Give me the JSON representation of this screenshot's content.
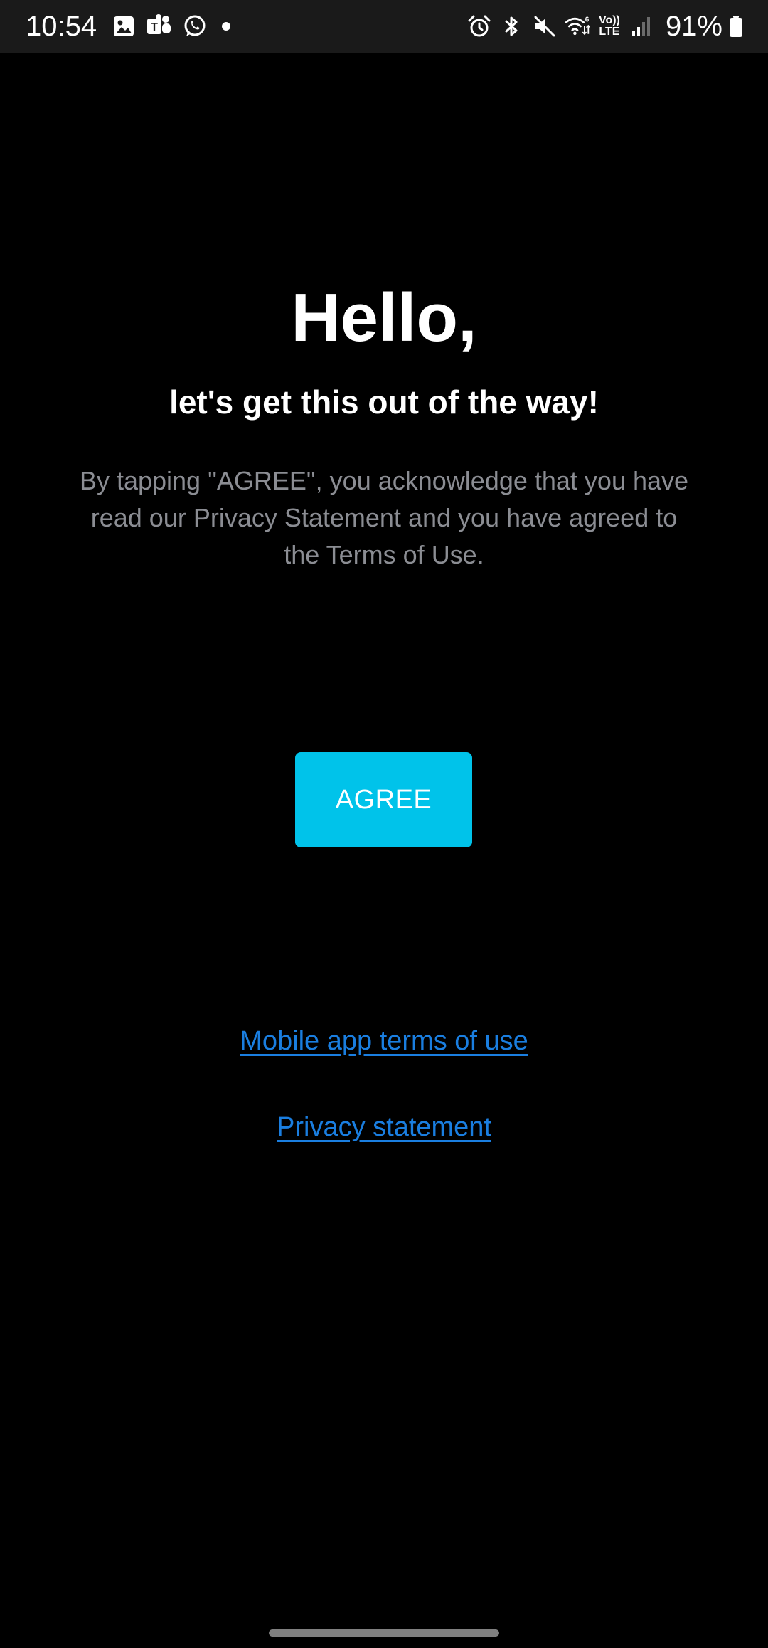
{
  "status_bar": {
    "time": "10:54",
    "left_icons": [
      "gallery-icon",
      "teams-icon",
      "whatsapp-icon",
      "notification-dot-icon"
    ],
    "right_icons": [
      "alarm-icon",
      "bluetooth-icon",
      "mute-icon",
      "wifi-icon",
      "volte-icon",
      "signal-icon",
      "battery-icon"
    ],
    "volte_top": "Vo))",
    "volte_bottom": "LTE",
    "wifi_badge": "6",
    "battery_percent": "91%"
  },
  "main": {
    "title": "Hello,",
    "subtitle": "let's get this out of the way!",
    "description": "By tapping \"AGREE\", you acknowledge that you have read our Privacy Statement and you have agreed to the Terms of Use.",
    "agree_label": "AGREE"
  },
  "links": {
    "terms": "Mobile app terms of use",
    "privacy": "Privacy statement"
  },
  "colors": {
    "background": "#000000",
    "accent_button": "#00c3ea",
    "link": "#1a7ee0",
    "muted_text": "#8b8d93"
  }
}
